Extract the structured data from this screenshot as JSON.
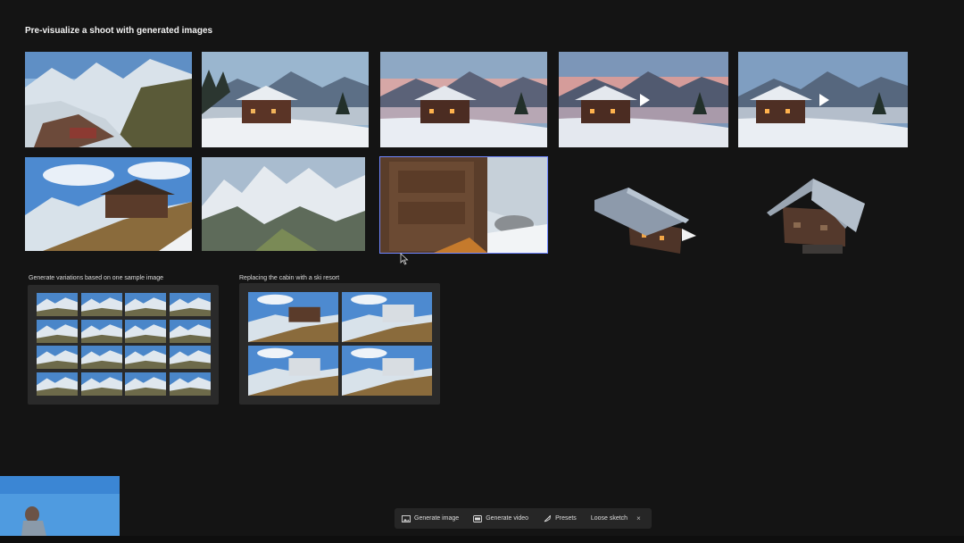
{
  "page": {
    "title": "Pre-visualize a shoot with generated images"
  },
  "sections": {
    "variations": {
      "label": "Generate variations based on one sample image"
    },
    "replace": {
      "label": "Replacing the cabin with a ski resort"
    }
  },
  "toolbar": {
    "generate_image": "Generate image",
    "generate_video": "Generate video",
    "presets": "Presets",
    "sketch": "Loose sketch",
    "close": "×"
  },
  "colors": {
    "accent": "#6f86ff",
    "background": "#141414",
    "panel": "#2a2a2a"
  }
}
